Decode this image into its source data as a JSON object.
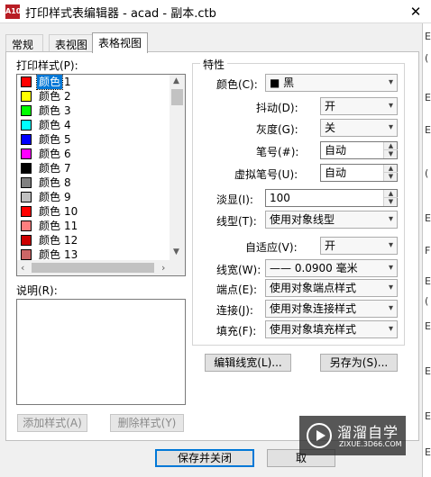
{
  "window": {
    "title": "打印样式表编辑器 - acad - 副本.ctb",
    "app_icon_text": "A10",
    "close_glyph": "✕"
  },
  "right_strip": {
    "fragments": [
      "E",
      "(",
      "E",
      "E",
      "(",
      "E",
      "F",
      "E",
      "(",
      "E",
      "E",
      "E",
      "E"
    ]
  },
  "tabs": [
    {
      "label": "常规",
      "active": false
    },
    {
      "label": "表视图",
      "active": false
    },
    {
      "label": "表格视图",
      "active": true
    }
  ],
  "styles_list": {
    "label": "打印样式(P):",
    "items": [
      {
        "label": "颜色",
        "num": "1",
        "color": "#ff0000",
        "selected": true
      },
      {
        "label": "颜色",
        "num": "2",
        "color": "#ffff00",
        "selected": false
      },
      {
        "label": "颜色",
        "num": "3",
        "color": "#00ff00",
        "selected": false
      },
      {
        "label": "颜色",
        "num": "4",
        "color": "#00ffff",
        "selected": false
      },
      {
        "label": "颜色",
        "num": "5",
        "color": "#0000ff",
        "selected": false
      },
      {
        "label": "颜色",
        "num": "6",
        "color": "#ff00ff",
        "selected": false
      },
      {
        "label": "颜色",
        "num": "7",
        "color": "#000000",
        "selected": false
      },
      {
        "label": "颜色",
        "num": "8",
        "color": "#808080",
        "selected": false
      },
      {
        "label": "颜色",
        "num": "9",
        "color": "#c0c0c0",
        "selected": false
      },
      {
        "label": "颜色",
        "num": "10",
        "color": "#ff0000",
        "selected": false
      },
      {
        "label": "颜色",
        "num": "11",
        "color": "#ff7f7f",
        "selected": false
      },
      {
        "label": "颜色",
        "num": "12",
        "color": "#cc0000",
        "selected": false
      },
      {
        "label": "颜色",
        "num": "13",
        "color": "#cc6666",
        "selected": false
      }
    ]
  },
  "description": {
    "label": "说明(R):",
    "value": ""
  },
  "buttons": {
    "add_style": "添加样式(A)",
    "delete_style": "删除样式(Y)",
    "edit_lineweight": "编辑线宽(L)...",
    "save_as": "另存为(S)...",
    "save_close": "保存并关闭",
    "cancel": "取"
  },
  "properties": {
    "group_title": "特性",
    "color": {
      "label": "颜色(C):",
      "value": "■ 黑"
    },
    "dither": {
      "label": "抖动(D):",
      "value": "开"
    },
    "grayscale": {
      "label": "灰度(G):",
      "value": "关"
    },
    "pen": {
      "label": "笔号(#):",
      "value": "自动"
    },
    "virtual_pen": {
      "label": "虚拟笔号(U):",
      "value": "自动"
    },
    "screening": {
      "label": "淡显(I):",
      "value": "100"
    },
    "linetype": {
      "label": "线型(T):",
      "value": "使用对象线型"
    },
    "adaptive": {
      "label": "自适应(V):",
      "value": "开"
    },
    "lineweight": {
      "label": "线宽(W):",
      "value": "—— 0.0900 毫米"
    },
    "endstyle": {
      "label": "端点(E):",
      "value": "使用对象端点样式"
    },
    "joinstyle": {
      "label": "连接(J):",
      "value": "使用对象连接样式"
    },
    "fillstyle": {
      "label": "填充(F):",
      "value": "使用对象填充样式"
    }
  },
  "watermark": {
    "title": "溜溜自学",
    "subtitle": "ZIXUE.3D66.COM"
  }
}
